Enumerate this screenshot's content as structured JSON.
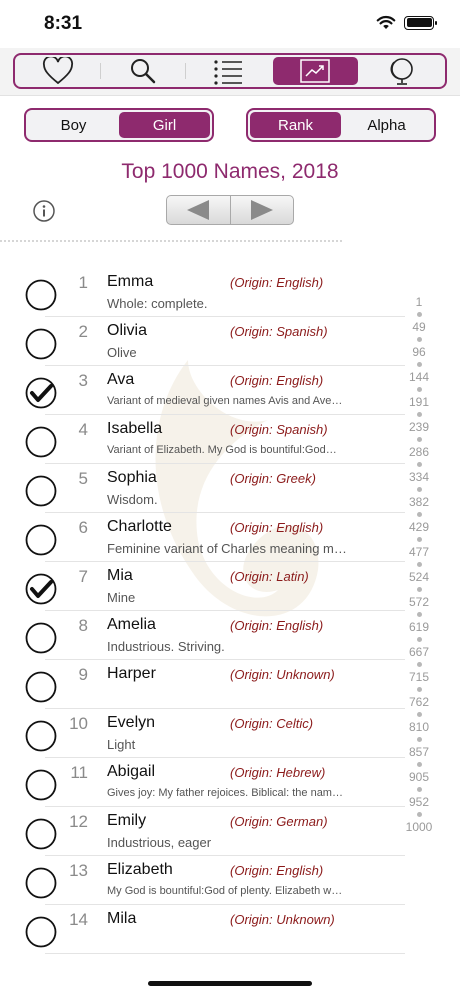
{
  "status": {
    "time": "8:31",
    "wifi_icon": "wifi-icon",
    "battery_icon": "battery-icon"
  },
  "toolbar": {
    "items": [
      {
        "icon": "heart-icon",
        "active": false
      },
      {
        "icon": "search-icon",
        "active": false
      },
      {
        "icon": "list-icon",
        "active": false
      },
      {
        "icon": "trend-chart-icon",
        "active": true
      },
      {
        "icon": "globe-icon",
        "active": false
      }
    ]
  },
  "gender_segment": {
    "options": [
      "Boy",
      "Girl"
    ],
    "selected": "Girl"
  },
  "sort_segment": {
    "options": [
      "Rank",
      "Alpha"
    ],
    "selected": "Rank"
  },
  "title": "Top 1000 Names, 2018",
  "colors": {
    "accent": "#8e2a6e",
    "origin": "#8b1a1a"
  },
  "names": [
    {
      "rank": "1",
      "name": "Emma",
      "origin": "(Origin: English)",
      "meaning": "Whole: complete.",
      "checked": false,
      "small": false
    },
    {
      "rank": "2",
      "name": "Olivia",
      "origin": "(Origin: Spanish)",
      "meaning": "Olive",
      "checked": false,
      "small": false
    },
    {
      "rank": "3",
      "name": "Ava",
      "origin": "(Origin: English)",
      "meaning": "Variant of medieval given names Avis and Ave…",
      "checked": true,
      "small": true
    },
    {
      "rank": "4",
      "name": "Isabella",
      "origin": "(Origin: Spanish)",
      "meaning": "Variant of Elizabeth. My God is bountiful:God…",
      "checked": false,
      "small": true
    },
    {
      "rank": "5",
      "name": "Sophia",
      "origin": "(Origin: Greek)",
      "meaning": "Wisdom.",
      "checked": false,
      "small": false
    },
    {
      "rank": "6",
      "name": "Charlotte",
      "origin": "(Origin: English)",
      "meaning": "Feminine variant of Charles meaning manly",
      "checked": false,
      "small": false
    },
    {
      "rank": "7",
      "name": "Mia",
      "origin": "(Origin: Latin)",
      "meaning": "Mine",
      "checked": true,
      "small": false
    },
    {
      "rank": "8",
      "name": "Amelia",
      "origin": "(Origin: English)",
      "meaning": "Industrious. Striving.",
      "checked": false,
      "small": false
    },
    {
      "rank": "9",
      "name": "Harper",
      "origin": "(Origin: Unknown)",
      "meaning": "",
      "checked": false,
      "small": false
    },
    {
      "rank": "10",
      "name": "Evelyn",
      "origin": "(Origin: Celtic)",
      "meaning": "Light",
      "checked": false,
      "small": false
    },
    {
      "rank": "11",
      "name": "Abigail",
      "origin": "(Origin: Hebrew)",
      "meaning": "Gives joy: My father rejoices. Biblical: the nam…",
      "checked": false,
      "small": true
    },
    {
      "rank": "12",
      "name": "Emily",
      "origin": "(Origin: German)",
      "meaning": "Industrious, eager",
      "checked": false,
      "small": false
    },
    {
      "rank": "13",
      "name": "Elizabeth",
      "origin": "(Origin: English)",
      "meaning": "My God is bountiful:God of plenty. Elizabeth w…",
      "checked": false,
      "small": true
    },
    {
      "rank": "14",
      "name": "Mila",
      "origin": "(Origin: Unknown)",
      "meaning": "",
      "checked": false,
      "small": false
    }
  ],
  "index_labels": [
    "1",
    "49",
    "96",
    "144",
    "191",
    "239",
    "286",
    "334",
    "382",
    "429",
    "477",
    "524",
    "572",
    "619",
    "667",
    "715",
    "762",
    "810",
    "857",
    "905",
    "952",
    "1000"
  ]
}
